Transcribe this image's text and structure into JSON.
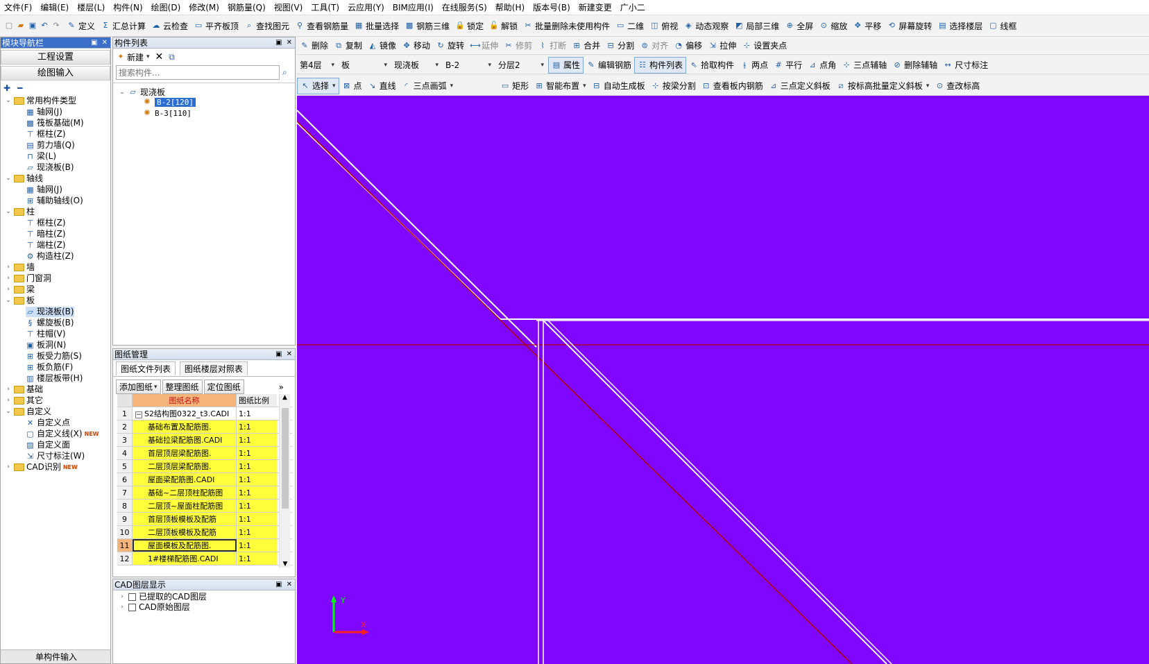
{
  "menu": [
    "文件(F)",
    "编辑(E)",
    "楼层(L)",
    "构件(N)",
    "绘图(D)",
    "修改(M)",
    "钢筋量(Q)",
    "视图(V)",
    "工具(T)",
    "云应用(Y)",
    "BIM应用(I)",
    "在线服务(S)",
    "帮助(H)",
    "版本号(B)",
    "新建变更",
    "广小二"
  ],
  "toolbar1": [
    "定义",
    "汇总计算",
    "云检查",
    "平齐板顶",
    "查找图元",
    "查看钢筋量",
    "批量选择",
    "钢筋三维",
    "锁定",
    "解锁",
    "批量删除未使用构件",
    "二维",
    "俯视",
    "动态观察",
    "局部三维",
    "全屏",
    "缩放",
    "平移",
    "屏幕旋转",
    "选择楼层",
    "线框"
  ],
  "edit_toolbar1": [
    "删除",
    "复制",
    "镜像",
    "移动",
    "旋转",
    "延伸",
    "修剪",
    "打断",
    "合并",
    "分割",
    "对齐",
    "偏移",
    "拉伸",
    "设置夹点"
  ],
  "edit_toolbar2": {
    "floor": "第4层",
    "category": "板",
    "type": "现浇板",
    "member": "B-2",
    "layer": "分层2",
    "buttons": [
      "属性",
      "编辑钢筋",
      "构件列表",
      "拾取构件",
      "两点",
      "平行",
      "点角",
      "三点辅轴",
      "删除辅轴",
      "尺寸标注"
    ]
  },
  "edit_toolbar3": [
    "选择",
    "点",
    "直线",
    "三点画弧",
    "矩形",
    "智能布置",
    "自动生成板",
    "按梁分割",
    "查看板内钢筋",
    "三点定义斜板",
    "按标高批量定义斜板",
    "查改标高"
  ],
  "nav": {
    "title": "模块导航栏",
    "btn_settings": "工程设置",
    "btn_draw": "绘图输入",
    "tree": [
      {
        "level": 0,
        "type": "folder",
        "label": "常用构件类型",
        "open": true
      },
      {
        "level": 1,
        "icon": "grid",
        "label": "轴网(J)"
      },
      {
        "level": 1,
        "icon": "raft",
        "label": "筏板基础(M)"
      },
      {
        "level": 1,
        "icon": "col",
        "label": "框柱(Z)"
      },
      {
        "level": 1,
        "icon": "wall",
        "label": "剪力墙(Q)"
      },
      {
        "level": 1,
        "icon": "beam",
        "label": "梁(L)"
      },
      {
        "level": 1,
        "icon": "slab",
        "label": "现浇板(B)"
      },
      {
        "level": 0,
        "type": "folder",
        "label": "轴线",
        "open": true
      },
      {
        "level": 1,
        "icon": "grid",
        "label": "轴网(J)"
      },
      {
        "level": 1,
        "icon": "aux",
        "label": "辅助轴线(O)"
      },
      {
        "level": 0,
        "type": "folder",
        "label": "柱",
        "open": true
      },
      {
        "level": 1,
        "icon": "col",
        "label": "框柱(Z)"
      },
      {
        "level": 1,
        "icon": "col",
        "label": "暗柱(Z)"
      },
      {
        "level": 1,
        "icon": "col",
        "label": "端柱(Z)"
      },
      {
        "level": 1,
        "icon": "gz",
        "label": "构造柱(Z)"
      },
      {
        "level": 0,
        "type": "folder",
        "label": "墙",
        "open": false
      },
      {
        "level": 0,
        "type": "folder",
        "label": "门窗洞",
        "open": false
      },
      {
        "level": 0,
        "type": "folder",
        "label": "梁",
        "open": false
      },
      {
        "level": 0,
        "type": "folder",
        "label": "板",
        "open": true
      },
      {
        "level": 1,
        "icon": "slab",
        "label": "现浇板(B)",
        "selected": true
      },
      {
        "level": 1,
        "icon": "spiral",
        "label": "螺旋板(B)"
      },
      {
        "level": 1,
        "icon": "cap",
        "label": "柱帽(V)"
      },
      {
        "level": 1,
        "icon": "hole",
        "label": "板洞(N)"
      },
      {
        "level": 1,
        "icon": "rebar",
        "label": "板受力筋(S)"
      },
      {
        "level": 1,
        "icon": "rebar",
        "label": "板负筋(F)"
      },
      {
        "level": 1,
        "icon": "band",
        "label": "楼层板带(H)"
      },
      {
        "level": 0,
        "type": "folder",
        "label": "基础",
        "open": false
      },
      {
        "level": 0,
        "type": "folder",
        "label": "其它",
        "open": false
      },
      {
        "level": 0,
        "type": "folder",
        "label": "自定义",
        "open": true
      },
      {
        "level": 1,
        "icon": "x",
        "label": "自定义点"
      },
      {
        "level": 1,
        "icon": "line",
        "label": "自定义线(X)",
        "new": "NEW"
      },
      {
        "level": 1,
        "icon": "face",
        "label": "自定义面"
      },
      {
        "level": 1,
        "icon": "dim",
        "label": "尺寸标注(W)"
      },
      {
        "level": 0,
        "type": "folder",
        "label": "CAD识别",
        "open": false,
        "new": "NEW"
      }
    ],
    "bottom_label": "单构件输入"
  },
  "member_list": {
    "title": "构件列表",
    "new_btn": "新建",
    "search_placeholder": "搜索构件...",
    "root": "现浇板",
    "items": [
      "B-2[120]",
      "B-3[110]"
    ],
    "selected_index": 0
  },
  "drawings": {
    "title": "图纸管理",
    "tabs": [
      "图纸文件列表",
      "图纸楼层对照表"
    ],
    "buttons": [
      "添加图纸",
      "整理图纸",
      "定位图纸"
    ],
    "header": {
      "name": "图纸名称",
      "scale": "图纸比例"
    },
    "rows": [
      {
        "no": "1",
        "name": "S2结构图0322_t3.CADI",
        "scale": "1:1",
        "root": true
      },
      {
        "no": "2",
        "name": "基础布置及配筋图.",
        "scale": "1:1"
      },
      {
        "no": "3",
        "name": "基础拉梁配筋图.CADI",
        "scale": "1:1"
      },
      {
        "no": "4",
        "name": "首层顶层梁配筋图.",
        "scale": "1:1"
      },
      {
        "no": "5",
        "name": "二层顶层梁配筋图.",
        "scale": "1:1"
      },
      {
        "no": "6",
        "name": "屋面梁配筋图.CADI",
        "scale": "1:1"
      },
      {
        "no": "7",
        "name": "基础~二层顶柱配筋图",
        "scale": "1:1"
      },
      {
        "no": "8",
        "name": "二层顶~屋面柱配筋图",
        "scale": "1:1"
      },
      {
        "no": "9",
        "name": "首层顶板模板及配筋",
        "scale": "1:1"
      },
      {
        "no": "10",
        "name": "二层顶板模板及配筋",
        "scale": "1:1"
      },
      {
        "no": "11",
        "name": "屋面模板及配筋图.",
        "scale": "1:1",
        "active": true
      },
      {
        "no": "12",
        "name": "1#楼梯配筋图.CADI",
        "scale": "1:1"
      }
    ]
  },
  "cad_layers": {
    "title": "CAD图层显示",
    "items": [
      "已提取的CAD图层",
      "CAD原始图层"
    ]
  },
  "axis": {
    "x": "X",
    "y": "Y"
  },
  "colors": {
    "canvas": "#7f06ff",
    "selected": "#cde0f7",
    "highlight": "#ffff3c"
  }
}
